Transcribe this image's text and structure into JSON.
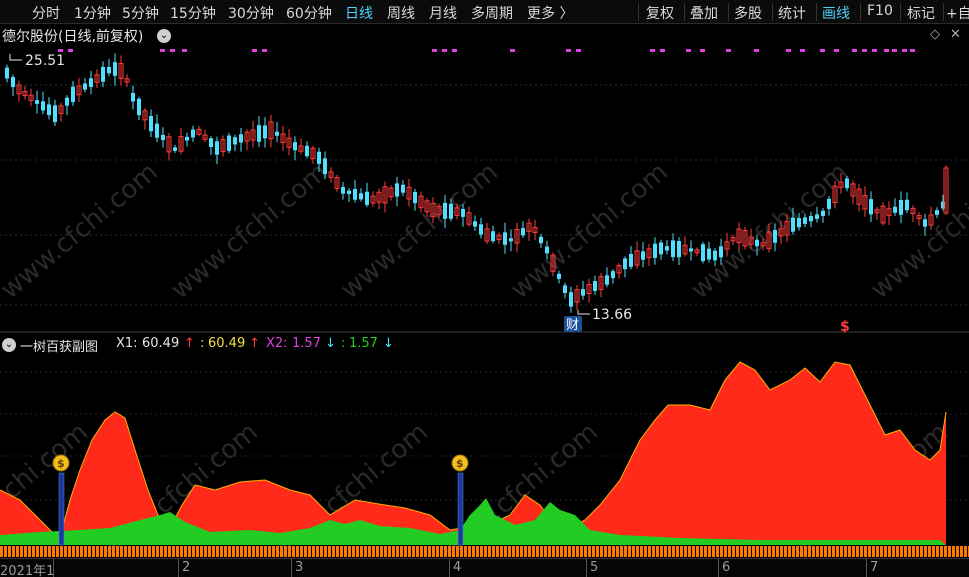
{
  "toolbar": {
    "periods": [
      "分时",
      "1分钟",
      "5分钟",
      "15分钟",
      "30分钟",
      "60分钟",
      "日线",
      "周线",
      "月线",
      "多周期",
      "更多 〉"
    ],
    "active_period": "日线",
    "tools": [
      "复权",
      "叠加",
      "多股",
      "统计",
      "画线",
      "F10",
      "标记",
      "+自"
    ],
    "active_tool": "画线"
  },
  "stock": {
    "title": "德尔股份(日线,前复权)",
    "dropdown_icon": "chevron-down-icon",
    "high_label": "25.51",
    "low_label": "13.66",
    "finance_badge": "财",
    "dollar_marker": "$"
  },
  "indicator": {
    "name": "一树百获副图",
    "x1_label": "X1:",
    "x1_value": "60.49",
    "x1_arrow": "↑",
    "x1b_label": ":",
    "x1b_value": "60.49",
    "x1b_arrow": "↑",
    "x2_label": "X2:",
    "x2_value": "1.57",
    "x2_arrow": "↓",
    "x2b_label": ":",
    "x2b_value": "1.57",
    "x2b_arrow": "↓"
  },
  "axis": {
    "dates": [
      "2021年1",
      "2",
      "3",
      "4",
      "5",
      "6",
      "7"
    ]
  },
  "watermark": "www.cfchi.com",
  "colors": {
    "up": "#ff3b3b",
    "down": "#50e0ff",
    "area_red": "#ff2a1a",
    "area_green": "#22cc22",
    "magenta": "#e040e0",
    "yellow": "#f0e040",
    "active": "#4fd2ff",
    "bar_orange": "#ff7a00"
  },
  "chart_data": {
    "type": "candlestick",
    "price_high": 25.51,
    "price_low": 13.66,
    "indicator_series": [
      {
        "name": "X1",
        "values": [
          60.49
        ]
      },
      {
        "name": "X2",
        "values": [
          1.57
        ]
      }
    ]
  }
}
